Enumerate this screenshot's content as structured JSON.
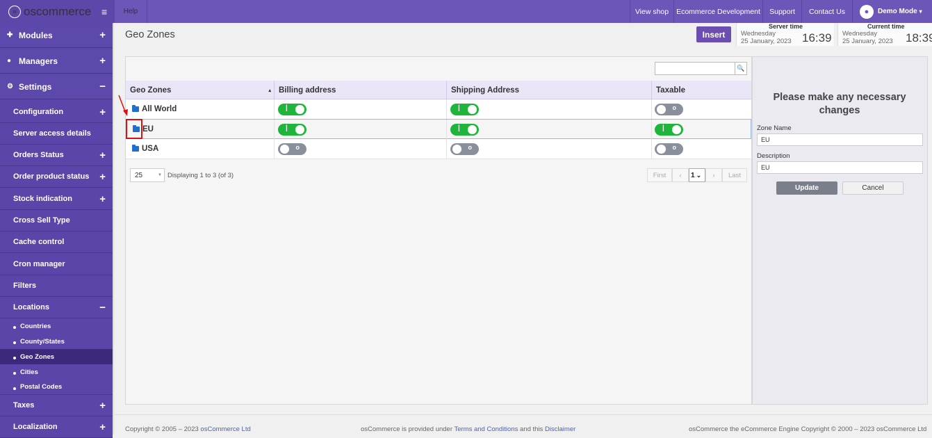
{
  "brand": {
    "name": "oscommerce"
  },
  "topbar": {
    "help": "Help",
    "links": [
      "View shop",
      "Ecommerce Development",
      "Support",
      "Contact Us"
    ],
    "user": "Demo Mode"
  },
  "sidebar": {
    "main": [
      {
        "label": "Modules",
        "toggle": "+"
      },
      {
        "label": "Managers",
        "toggle": "+"
      },
      {
        "label": "Settings",
        "toggle": "−"
      }
    ],
    "settings": [
      {
        "label": "Configuration",
        "toggle": "+"
      },
      {
        "label": "Server access details",
        "toggle": ""
      },
      {
        "label": "Orders Status",
        "toggle": "+"
      },
      {
        "label": "Order product status",
        "toggle": "+"
      },
      {
        "label": "Stock indication",
        "toggle": "+"
      },
      {
        "label": "Cross Sell Type",
        "toggle": ""
      },
      {
        "label": "Cache control",
        "toggle": ""
      },
      {
        "label": "Cron manager",
        "toggle": ""
      },
      {
        "label": "Filters",
        "toggle": ""
      },
      {
        "label": "Locations",
        "toggle": "−"
      }
    ],
    "locations": [
      "Countries",
      "County/States",
      "Geo Zones",
      "Cities",
      "Postal Codes"
    ],
    "after": [
      {
        "label": "Taxes",
        "toggle": "+"
      },
      {
        "label": "Localization",
        "toggle": "+"
      }
    ]
  },
  "header": {
    "title": "Geo Zones",
    "insert": "Insert",
    "server_time": {
      "label": "Server time",
      "day": "Wednesday",
      "date": "25 January, 2023",
      "time": "16:39"
    },
    "current_time": {
      "label": "Current time",
      "day": "Wednesday",
      "date": "25 January, 2023",
      "time": "18:39"
    }
  },
  "table": {
    "columns": [
      "Geo Zones",
      "Billing address",
      "Shipping Address",
      "Taxable"
    ],
    "rows": [
      {
        "name": "All World",
        "billing": true,
        "shipping": true,
        "taxable": false
      },
      {
        "name": "EU",
        "billing": true,
        "shipping": true,
        "taxable": true
      },
      {
        "name": "USA",
        "billing": false,
        "shipping": false,
        "taxable": false
      }
    ],
    "per_page": "25",
    "displaying": "Displaying 1 to 3 (of 3)",
    "pagination": {
      "first": "First",
      "page": "1",
      "last": "Last"
    }
  },
  "edit_panel": {
    "title": "Please make any necessary changes",
    "zone_name_label": "Zone Name",
    "zone_name": "EU",
    "description_label": "Description",
    "description": "EU",
    "update": "Update",
    "cancel": "Cancel"
  },
  "footer": {
    "copyright": "Copyright © 2005 – 2023",
    "company": "osCommerce Ltd",
    "provided_pre": "osCommerce is provided under",
    "terms": "Terms and Conditions",
    "and_this": "and this",
    "disclaimer": "Disclaimer",
    "right": "osCommerce the eCommerce Engine Copyright © 2000 – 2023 osCommerce Ltd"
  },
  "colors": {
    "accent": "#6c56b8",
    "sidebar": "#5b45a8",
    "toggle_on": "#1eb53a",
    "toggle_off": "#8a8f9c"
  }
}
